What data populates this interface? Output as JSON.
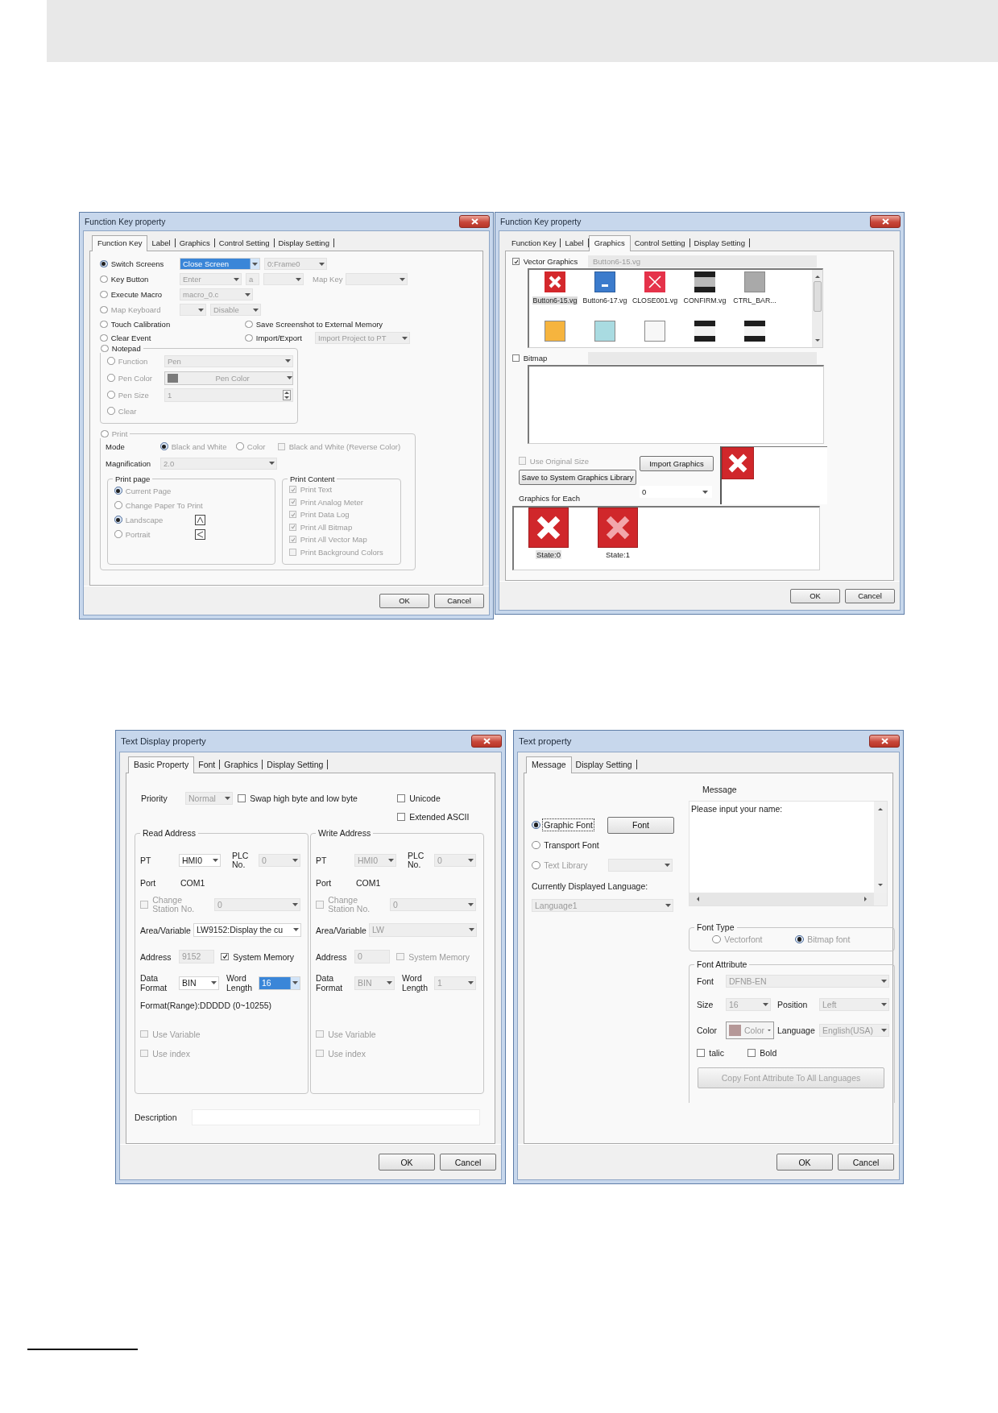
{
  "function_key_dialog": {
    "title": "Function Key property",
    "tabs": [
      {
        "label": "Function Key",
        "selected": true
      },
      {
        "label": "Label",
        "selected": false
      },
      {
        "label": "Graphics",
        "selected": false
      },
      {
        "label": "Control Setting",
        "selected": false
      },
      {
        "label": "Display Setting",
        "selected": false
      }
    ],
    "switch_screens": {
      "label": "Switch Screens",
      "selected": true,
      "action": {
        "value": "Close Screen",
        "highlighted": true
      },
      "frame": {
        "value": "0:Frame0",
        "disabled": true
      }
    },
    "key_button": {
      "label": "Key Button",
      "selected": false,
      "key": {
        "value": "Enter",
        "disabled": true
      },
      "character": {
        "value": "a",
        "disabled": true
      },
      "key_code": {
        "disabled": true
      },
      "map_key_label": "Map Key",
      "map_key": {
        "disabled": true
      }
    },
    "execute_macro": {
      "label": "Execute Macro",
      "selected": false,
      "macro": {
        "value": "macro_0.c",
        "disabled": true
      }
    },
    "map_keyboard": {
      "label": "Map Keyboard",
      "selected": false,
      "disabled": true,
      "keyboard": {
        "disabled": true
      },
      "mode": {
        "value": "Disable",
        "disabled": true
      }
    },
    "touch_calibration": {
      "label": "Touch Calibration",
      "selected": false
    },
    "save_screenshot": {
      "label": "Save Screenshot to External Memory",
      "selected": false
    },
    "clear_event": {
      "label": "Clear Event",
      "selected": false
    },
    "import_export": {
      "label": "Import/Export",
      "selected": false,
      "operation": {
        "value": "Import Project to PT",
        "disabled": true
      }
    },
    "notepad": {
      "label": "Notepad",
      "selected": false,
      "options": [
        {
          "kind": "dropdown",
          "label": "Function",
          "selected": false,
          "disabled": true,
          "value": "Pen"
        },
        {
          "kind": "color",
          "label": "Pen Color",
          "selected": false,
          "disabled": true,
          "value": "Pen Color"
        },
        {
          "kind": "spinner",
          "label": "Pen Size",
          "selected": false,
          "disabled": true,
          "value": "1"
        },
        {
          "kind": "plain",
          "label": "Clear",
          "selected": false,
          "disabled": true
        }
      ]
    },
    "print": {
      "label": "Print",
      "selected": false,
      "disabled": true,
      "mode_label": "Mode",
      "modes": [
        {
          "label": "Black and White",
          "selected": true,
          "disabled": true
        },
        {
          "label": "Color",
          "selected": false,
          "disabled": true
        }
      ],
      "reverse": {
        "label": "Black and White (Reverse Color)",
        "checked": false,
        "disabled": true
      },
      "magnification_label": "Magnification",
      "magnification": {
        "value": "2.0",
        "disabled": true
      },
      "print_page": {
        "title": "Print page",
        "options": [
          {
            "label": "Current Page",
            "selected": true,
            "disabled": true
          },
          {
            "label": "Change Paper To Print",
            "selected": false,
            "disabled": true
          }
        ],
        "orientations": [
          {
            "label": "Landscape",
            "selected": true,
            "disabled": true
          },
          {
            "label": "Portrait",
            "selected": false,
            "disabled": true
          }
        ]
      },
      "print_content": {
        "title": "Print Content",
        "items": [
          {
            "label": "Print Text",
            "checked": true,
            "disabled": true
          },
          {
            "label": "Print Analog Meter",
            "checked": true,
            "disabled": true
          },
          {
            "label": "Print Data Log",
            "checked": true,
            "disabled": true
          },
          {
            "label": "Print All Bitmap",
            "checked": true,
            "disabled": true
          },
          {
            "label": "Print All Vector Map",
            "checked": true,
            "disabled": true
          },
          {
            "label": "Print Background Colors",
            "checked": false,
            "disabled": true
          }
        ]
      }
    },
    "buttons": [
      "OK",
      "Cancel"
    ]
  },
  "graphics_dialog": {
    "title": "Function Key property",
    "tabs": [
      {
        "label": "Function Key",
        "selected": false
      },
      {
        "label": "Label",
        "selected": false
      },
      {
        "label": "Graphics",
        "selected": true
      },
      {
        "label": "Control Setting",
        "selected": false
      },
      {
        "label": "Display Setting",
        "selected": false
      }
    ],
    "vector_graphics": {
      "label": "Vector Graphics",
      "checked": true,
      "file": "Button6-15.vg"
    },
    "gallery": [
      {
        "kind": "cross",
        "color": "#d4282c",
        "label": "Button6-15.vg",
        "selected": true
      },
      {
        "kind": "minus",
        "color": "#3b7bcc",
        "label": "Button6-17.vg",
        "selected": false
      },
      {
        "kind": "thincross",
        "color": "#e5324a",
        "label": "CLOSE001.vg",
        "selected": false
      },
      {
        "kind": "stripes",
        "color": "#b9b9b9",
        "label": "CONFIRM.vg",
        "selected": false
      },
      {
        "kind": "tile",
        "color": "#a9a9a9",
        "label": "CTRL_BAR...",
        "selected": false
      },
      {
        "kind": "tile",
        "color": "#f6b43e"
      },
      {
        "kind": "tile",
        "color": "#a9dbe1"
      },
      {
        "kind": "tile",
        "color": "#f7f7f7"
      },
      {
        "kind": "stripes",
        "color": "#f2f2f2"
      },
      {
        "kind": "stripes",
        "color": "#f4f4f4"
      }
    ],
    "bitmap": {
      "label": "Bitmap",
      "checked": false
    },
    "use_original_size": {
      "label": "Use Original Size",
      "checked": false,
      "disabled": true
    },
    "import_button": "Import Graphics",
    "save_button": "Save to System Graphics Library",
    "graphics_for_each_label": "Graphics for Each",
    "state_select": {
      "value": "0"
    },
    "states": [
      {
        "label": "State:0",
        "kind": "solid",
        "selected": true
      },
      {
        "label": "State:1",
        "kind": "faded",
        "selected": false
      }
    ],
    "buttons": [
      "OK",
      "Cancel"
    ]
  },
  "text_display_dialog": {
    "title": "Text Display property",
    "tabs": [
      {
        "label": "Basic Property",
        "selected": true
      },
      {
        "label": "Font",
        "selected": false
      },
      {
        "label": "Graphics",
        "selected": false
      },
      {
        "label": "Display Setting",
        "selected": false
      }
    ],
    "priority_label": "Priority",
    "priority": {
      "value": "Normal",
      "disabled": true
    },
    "swap": {
      "label": "Swap high byte and low byte",
      "checked": false
    },
    "unicode": {
      "label": "Unicode",
      "checked": false
    },
    "extended_ascii": {
      "label": "Extended ASCII",
      "checked": false
    },
    "addresses": [
      {
        "title": "Read Address",
        "pt_label": "PT",
        "pt": {
          "value": "HMI0",
          "disabled": false
        },
        "plc_label": "PLC No.",
        "plc": {
          "value": "0",
          "disabled": true
        },
        "port_label": "Port",
        "port": "COM1",
        "change_station": {
          "label": "Change Station No.",
          "checked": false,
          "disabled": true
        },
        "station": {
          "value": "0",
          "disabled": true
        },
        "area_label": "Area/Variable",
        "area": {
          "value": "LW9152:Display the cu",
          "disabled": false
        },
        "address_label": "Address",
        "address": {
          "value": "9152",
          "disabled": true
        },
        "system_memory": {
          "label": "System Memory",
          "checked": true,
          "disabled": false
        },
        "format_label": "Data Format",
        "format": {
          "value": "BIN",
          "disabled": false
        },
        "length_label": "Word Length",
        "length": {
          "value": "16",
          "disabled": false,
          "highlighted": true
        },
        "range": "Format(Range):DDDDD (0~10255)",
        "use_variable": {
          "label": "Use Variable",
          "checked": false,
          "disabled": true
        },
        "use_index": {
          "label": "Use index",
          "checked": false,
          "disabled": true
        }
      },
      {
        "title": "Write Address",
        "pt_label": "PT",
        "pt": {
          "value": "HMI0",
          "disabled": true
        },
        "plc_label": "PLC No.",
        "plc": {
          "value": "0",
          "disabled": true
        },
        "port_label": "Port",
        "port": "COM1",
        "change_station": {
          "label": "Change Station No.",
          "checked": false,
          "disabled": true
        },
        "station": {
          "value": "0",
          "disabled": true
        },
        "area_label": "Area/Variable",
        "area": {
          "value": "LW",
          "disabled": true
        },
        "address_label": "Address",
        "address": {
          "value": "0",
          "disabled": true
        },
        "system_memory": {
          "label": "System Memory",
          "checked": false,
          "disabled": true
        },
        "format_label": "Data Format",
        "format": {
          "value": "BIN",
          "disabled": true
        },
        "length_label": "Word Length",
        "length": {
          "value": "1",
          "disabled": true,
          "highlighted": false
        },
        "use_variable": {
          "label": "Use Variable",
          "checked": false,
          "disabled": true
        },
        "use_index": {
          "label": "Use index",
          "checked": false,
          "disabled": true
        }
      }
    ],
    "description_label": "Description",
    "buttons": [
      "OK",
      "Cancel"
    ]
  },
  "text_property_dialog": {
    "title": "Text property",
    "tabs": [
      {
        "label": "Message",
        "selected": true
      },
      {
        "label": "Display Setting",
        "selected": false
      }
    ],
    "sources": [
      {
        "label": "Graphic Font",
        "selected": true,
        "disabled": false,
        "focused": true
      },
      {
        "label": "Transport Font",
        "selected": false,
        "disabled": false,
        "focused": false
      },
      {
        "label": "Text Library",
        "selected": false,
        "disabled": true,
        "focused": false
      }
    ],
    "font_button": "Font",
    "library": {
      "disabled": true
    },
    "language_label": "Currently Displayed Language:",
    "language": {
      "value": "Language1",
      "disabled": true
    },
    "message_label": "Message",
    "message": "Please input your name:",
    "font_type": {
      "title": "Font Type",
      "options": [
        {
          "label": "Vectorfont",
          "selected": false,
          "disabled": true
        },
        {
          "label": "Bitmap font",
          "selected": true,
          "disabled": true
        }
      ]
    },
    "font_attribute": {
      "title": "Font Attribute",
      "font_label": "Font",
      "font": {
        "value": "DFNB-EN",
        "disabled": true
      },
      "size_label": "Size",
      "size": {
        "value": "16",
        "disabled": true
      },
      "position_label": "Position",
      "position": {
        "value": "Left",
        "disabled": true
      },
      "color_label": "Color",
      "color_button": "Color",
      "language_label": "Language",
      "language": {
        "value": "English(USA)",
        "disabled": true
      },
      "styles": [
        {
          "label": "talic",
          "checked": false
        },
        {
          "label": "Bold",
          "checked": false
        }
      ],
      "copy_button": {
        "label": "Copy Font Attribute To All Languages",
        "disabled": true
      }
    },
    "buttons": [
      "OK",
      "Cancel"
    ]
  }
}
